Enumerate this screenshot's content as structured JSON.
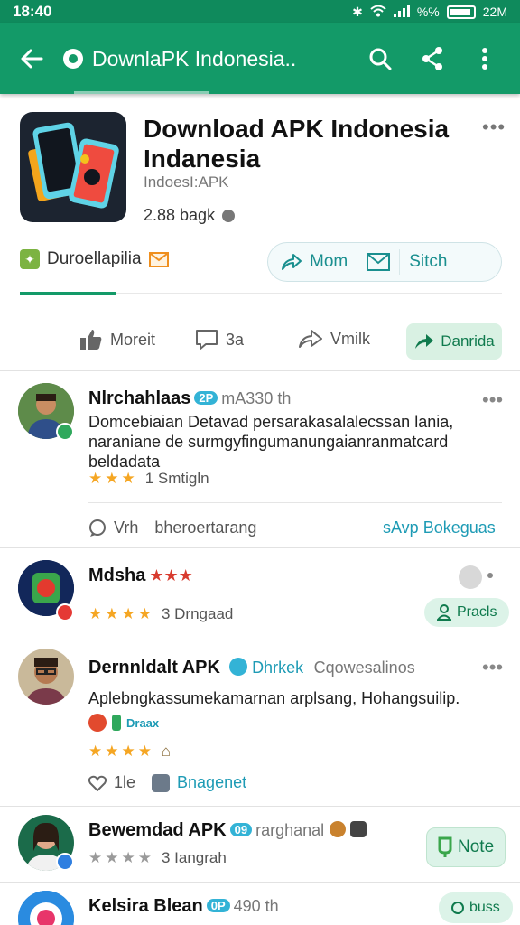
{
  "status_bar": {
    "time": "18:40",
    "battery": "%%",
    "clock_right": "22M"
  },
  "app_bar": {
    "title": "DownlaPK Indonesia.."
  },
  "app": {
    "name_line1": "Download APK Indonesia",
    "name_line2": "Indanesia",
    "subtitle": "IndoesI:APK",
    "size": "2.88 bagk",
    "developer": "Duroellapilia"
  },
  "pill": {
    "view_label": "Mom",
    "share_label": "Sitch"
  },
  "actions": {
    "like": "Moreit",
    "comment": "3a",
    "share": "Vmilk",
    "download": "Danrida"
  },
  "reviews": [
    {
      "name": "Nlrchahlaas",
      "tag": "2P",
      "meta": "mA330 th",
      "text": "Domcebiaian Detavad persarakasalalecssan lania, naraniane de surmgyfingumanungaianranmatcard beldadata",
      "stars_label": "★★★",
      "count": "1 Smtigln",
      "reply": "Vrh",
      "footer_text": "bheroertarang",
      "link": "sAvp Bokeguas"
    },
    {
      "name": "Mdsha",
      "name_stars": "★★★",
      "stars_label": "★★★★",
      "count": "3 Drngaad",
      "chip": "Pracls"
    },
    {
      "name": "Dernnldalt APK",
      "tag_text": "Dhrkek",
      "meta": "Cqowesalinos",
      "text": "Aplebngkassumekamarnan arplsang, Hohangsuilip.",
      "sub_tag": "Draax",
      "stars_label": "★★★★",
      "reply": "1le",
      "link": "Bnagenet"
    },
    {
      "name": "Bewemdad APK",
      "tag": "09",
      "meta": "rarghanal",
      "stars_label": "★★★★",
      "count": "3 Iangrah",
      "chip": "Note"
    },
    {
      "name": "Kelsira Blean",
      "tag": "0P",
      "meta": "490 th",
      "chip": "buss"
    }
  ],
  "colors": {
    "primary": "#139a68",
    "accent": "#1e9bb5",
    "star": "#f5a623"
  }
}
